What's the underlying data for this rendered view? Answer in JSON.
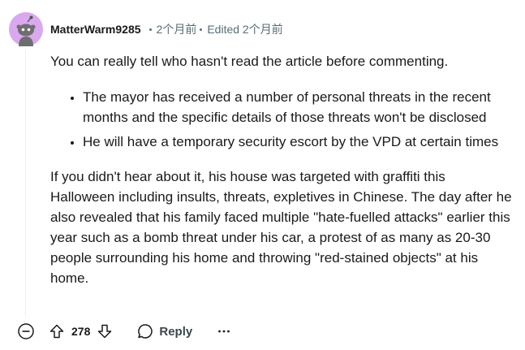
{
  "comment": {
    "username": "MatterWarm9285",
    "posted_time": "2个月前",
    "edited_label": "Edited 2个月前",
    "intro": "You can really tell who hasn't read the article before commenting.",
    "bullets": [
      "The mayor has received a number of personal threats in the recent months and the specific details of those threats won't be disclosed",
      "He will have a temporary security escort by the VPD at certain times"
    ],
    "paragraph": "If you didn't hear about it, his house was targeted with graffiti this Halloween including insults, threats, expletives in Chinese. The day after he also revealed that his family faced multiple \"hate-fuelled attacks\" earlier this year such as a bomb threat under his car, a protest of as many as 20-30 people surrounding his home and throwing \"red-stained objects\" at his home."
  },
  "actions": {
    "vote_count": "278",
    "reply_label": "Reply"
  },
  "icons": {
    "collapse": "collapse-minus-icon",
    "upvote": "upvote-arrow-icon",
    "downvote": "downvote-arrow-icon",
    "reply": "speech-bubble-icon",
    "more": "ellipsis-icon",
    "avatar": "snoo-avatar"
  },
  "colors": {
    "avatar_bg": "#d9a8ee",
    "meta_text": "#576f76",
    "text": "#1a1a1b"
  }
}
